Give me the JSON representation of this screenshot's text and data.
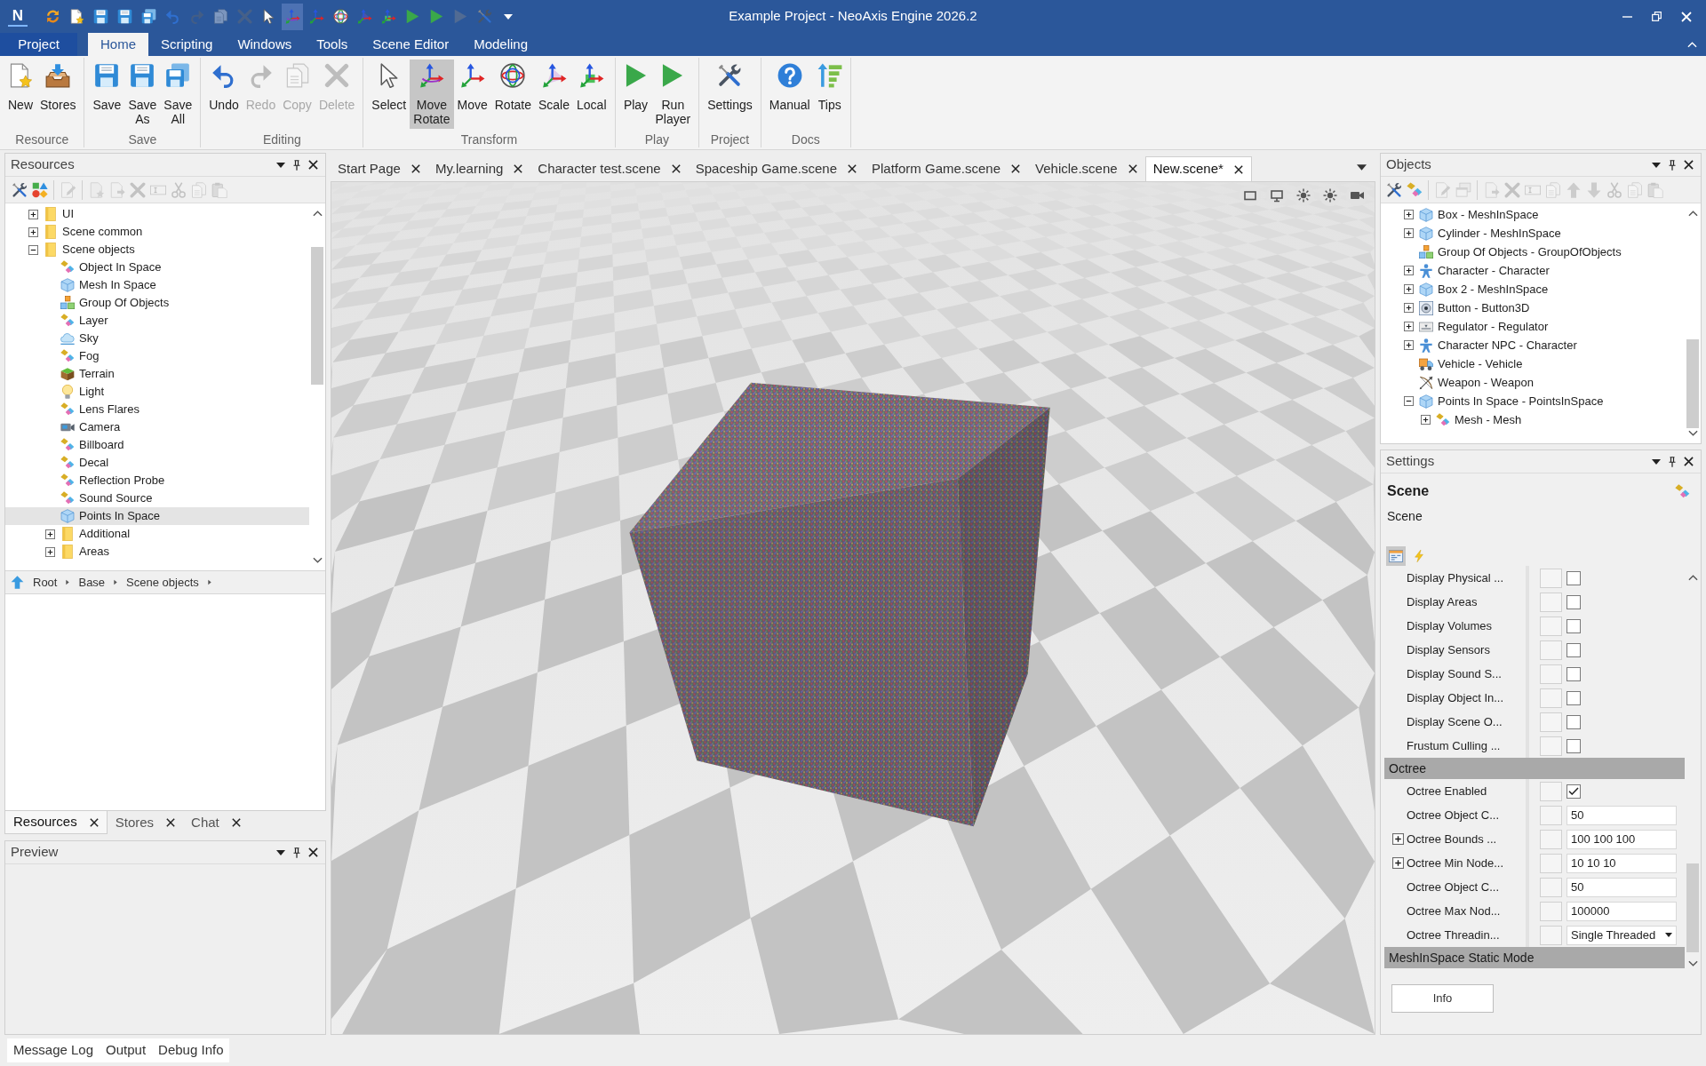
{
  "window": {
    "logo": "N",
    "title": "Example Project - NeoAxis Engine 2026.2"
  },
  "quick_access": [
    {
      "kind": "refresh",
      "selected": false,
      "disabled": false
    },
    {
      "kind": "new",
      "selected": false,
      "disabled": false
    },
    {
      "kind": "save",
      "selected": false,
      "disabled": false
    },
    {
      "kind": "saveas",
      "selected": false,
      "disabled": false
    },
    {
      "kind": "saveall",
      "selected": false,
      "disabled": false
    },
    {
      "kind": "undo",
      "selected": false,
      "disabled": false
    },
    {
      "kind": "redo",
      "selected": false,
      "disabled": true
    },
    {
      "kind": "copy",
      "selected": false,
      "disabled": true
    },
    {
      "kind": "delete",
      "selected": false,
      "disabled": true
    },
    {
      "kind": "select",
      "selected": false,
      "disabled": false
    },
    {
      "kind": "moverotate",
      "selected": true,
      "disabled": false
    },
    {
      "kind": "move",
      "selected": false,
      "disabled": false
    },
    {
      "kind": "rotate",
      "selected": false,
      "disabled": false
    },
    {
      "kind": "scale",
      "selected": false,
      "disabled": false
    },
    {
      "kind": "local",
      "selected": false,
      "disabled": false
    },
    {
      "kind": "play",
      "selected": false,
      "disabled": false
    },
    {
      "kind": "runplayer",
      "selected": false,
      "disabled": false
    },
    {
      "kind": "play",
      "selected": false,
      "disabled": true
    },
    {
      "kind": "settings",
      "selected": false,
      "disabled": false
    },
    {
      "kind": "customize",
      "selected": false,
      "disabled": false
    }
  ],
  "ribbon": {
    "tabs": [
      {
        "label": "Project",
        "kind": "menu",
        "selected": false
      },
      {
        "label": "Home",
        "kind": "tab",
        "selected": true
      },
      {
        "label": "Scripting",
        "kind": "tab",
        "selected": false
      },
      {
        "label": "Windows",
        "kind": "tab",
        "selected": false
      },
      {
        "label": "Tools",
        "kind": "tab",
        "selected": false
      },
      {
        "label": "Scene Editor",
        "kind": "tab",
        "selected": false
      },
      {
        "label": "Modeling",
        "kind": "tab",
        "selected": false
      }
    ],
    "groups": [
      {
        "label": "Resource",
        "buttons": [
          {
            "kind": "new",
            "label": "New",
            "selected": false,
            "disabled": false
          },
          {
            "kind": "stores",
            "label": "Stores",
            "selected": false,
            "disabled": false
          }
        ]
      },
      {
        "label": "Save",
        "buttons": [
          {
            "kind": "save",
            "label": "Save",
            "selected": false,
            "disabled": false
          },
          {
            "kind": "saveas",
            "label": "Save As",
            "selected": false,
            "disabled": false
          },
          {
            "kind": "saveall",
            "label": "Save All",
            "selected": false,
            "disabled": false
          }
        ]
      },
      {
        "label": "Editing",
        "buttons": [
          {
            "kind": "undo",
            "label": "Undo",
            "selected": false,
            "disabled": false
          },
          {
            "kind": "redo",
            "label": "Redo",
            "selected": false,
            "disabled": true
          },
          {
            "kind": "copy",
            "label": "Copy",
            "selected": false,
            "disabled": true
          },
          {
            "kind": "delete",
            "label": "Delete",
            "selected": false,
            "disabled": true
          }
        ]
      },
      {
        "label": "Transform",
        "buttons": [
          {
            "kind": "select",
            "label": "Select",
            "selected": false,
            "disabled": false
          },
          {
            "kind": "moverotate",
            "label": "Move Rotate",
            "selected": true,
            "disabled": false
          },
          {
            "kind": "move",
            "label": "Move",
            "selected": false,
            "disabled": false
          },
          {
            "kind": "rotate",
            "label": "Rotate",
            "selected": false,
            "disabled": false
          },
          {
            "kind": "scale",
            "label": "Scale",
            "selected": false,
            "disabled": false
          },
          {
            "kind": "local",
            "label": "Local",
            "selected": false,
            "disabled": false
          }
        ]
      },
      {
        "label": "Play",
        "buttons": [
          {
            "kind": "play",
            "label": "Play",
            "selected": false,
            "disabled": false
          },
          {
            "kind": "runplayer",
            "label": "Run Player",
            "selected": false,
            "disabled": false
          }
        ]
      },
      {
        "label": "Project",
        "buttons": [
          {
            "kind": "settings",
            "label": "Settings",
            "selected": false,
            "disabled": false
          }
        ]
      },
      {
        "label": "Docs",
        "buttons": [
          {
            "kind": "manual",
            "label": "Manual",
            "selected": false,
            "disabled": false
          },
          {
            "kind": "tips",
            "label": "Tips",
            "selected": false,
            "disabled": false
          }
        ]
      }
    ]
  },
  "resources_panel": {
    "title": "Resources",
    "toolbar": [
      {
        "kind": "settings",
        "disabled": false
      },
      {
        "kind": "create",
        "disabled": false
      },
      {
        "kind": "separator"
      },
      {
        "kind": "edit",
        "disabled": true
      },
      {
        "kind": "separator"
      },
      {
        "kind": "add",
        "disabled": true
      },
      {
        "kind": "import",
        "disabled": true
      },
      {
        "kind": "delete",
        "disabled": true
      },
      {
        "kind": "rename",
        "disabled": true
      },
      {
        "kind": "cut",
        "disabled": true
      },
      {
        "kind": "copy",
        "disabled": true
      },
      {
        "kind": "paste",
        "disabled": true
      }
    ],
    "tree": [
      {
        "label": "UI",
        "kind": "folder",
        "expanded": false,
        "selected": false
      },
      {
        "label": "Scene common",
        "kind": "folder",
        "expanded": false,
        "selected": false
      },
      {
        "label": "Scene objects",
        "kind": "folder",
        "expanded": true,
        "selected": false,
        "children": [
          {
            "label": "Object In Space",
            "kind": "component",
            "selected": false
          },
          {
            "label": "Mesh In Space",
            "kind": "mesh",
            "selected": false
          },
          {
            "label": "Group Of Objects",
            "kind": "group",
            "selected": false
          },
          {
            "label": "Layer",
            "kind": "component",
            "selected": false
          },
          {
            "label": "Sky",
            "kind": "sky",
            "selected": false
          },
          {
            "label": "Fog",
            "kind": "component",
            "selected": false
          },
          {
            "label": "Terrain",
            "kind": "terrain",
            "selected": false
          },
          {
            "label": "Light",
            "kind": "light",
            "selected": false
          },
          {
            "label": "Lens Flares",
            "kind": "component",
            "selected": false
          },
          {
            "label": "Camera",
            "kind": "camera",
            "selected": false
          },
          {
            "label": "Billboard",
            "kind": "component",
            "selected": false
          },
          {
            "label": "Decal",
            "kind": "component",
            "selected": false
          },
          {
            "label": "Reflection Probe",
            "kind": "component",
            "selected": false
          },
          {
            "label": "Sound Source",
            "kind": "component",
            "selected": false
          },
          {
            "label": "Points In Space",
            "kind": "mesh",
            "selected": true
          },
          {
            "label": "Additional",
            "kind": "folder",
            "expanded": false,
            "selected": false
          },
          {
            "label": "Areas",
            "kind": "folder",
            "expanded": false,
            "selected": false
          }
        ]
      }
    ],
    "breadcrumb": [
      "Root",
      "Base",
      "Scene objects"
    ],
    "tabs": [
      {
        "label": "Resources",
        "selected": true
      },
      {
        "label": "Stores",
        "selected": false
      },
      {
        "label": "Chat",
        "selected": false
      }
    ]
  },
  "preview_panel": {
    "title": "Preview"
  },
  "document_tabs": [
    {
      "label": "Start Page",
      "selected": false
    },
    {
      "label": "My.learning",
      "selected": false
    },
    {
      "label": "Character test.scene",
      "selected": false
    },
    {
      "label": "Spaceship Game.scene",
      "selected": false
    },
    {
      "label": "Platform Game.scene",
      "selected": false
    },
    {
      "label": "Vehicle.scene",
      "selected": false
    },
    {
      "label": "New.scene*",
      "selected": true
    }
  ],
  "objects_panel": {
    "title": "Objects",
    "toolbar": [
      {
        "kind": "settings",
        "disabled": false
      },
      {
        "kind": "component",
        "disabled": false
      },
      {
        "kind": "separator"
      },
      {
        "kind": "edit",
        "disabled": true
      },
      {
        "kind": "windows",
        "disabled": true
      },
      {
        "kind": "separator"
      },
      {
        "kind": "import",
        "disabled": true
      },
      {
        "kind": "delete",
        "disabled": true
      },
      {
        "kind": "rename",
        "disabled": true
      },
      {
        "kind": "duplicate",
        "disabled": true
      },
      {
        "kind": "moveup",
        "disabled": true
      },
      {
        "kind": "movedown",
        "disabled": true
      },
      {
        "kind": "cut",
        "disabled": true
      },
      {
        "kind": "copy",
        "disabled": true
      },
      {
        "kind": "paste",
        "disabled": true
      }
    ],
    "tree": [
      {
        "label": "Box - MeshInSpace",
        "kind": "mesh",
        "expanded": false,
        "selected": false
      },
      {
        "label": "Cylinder - MeshInSpace",
        "kind": "mesh",
        "expanded": false,
        "selected": false
      },
      {
        "label": "Group Of Objects - GroupOfObjects",
        "kind": "group",
        "selected": false
      },
      {
        "label": "Character - Character",
        "kind": "character",
        "expanded": false,
        "selected": false
      },
      {
        "label": "Box 2 - MeshInSpace",
        "kind": "mesh",
        "expanded": false,
        "selected": false
      },
      {
        "label": "Button - Button3D",
        "kind": "button",
        "expanded": false,
        "selected": false
      },
      {
        "label": "Regulator - Regulator",
        "kind": "regulator",
        "expanded": false,
        "selected": false
      },
      {
        "label": "Character NPC - Character",
        "kind": "character",
        "expanded": false,
        "selected": false
      },
      {
        "label": "Vehicle - Vehicle",
        "kind": "vehicle",
        "selected": false
      },
      {
        "label": "Weapon - Weapon",
        "kind": "weapon",
        "selected": false
      },
      {
        "label": "Points In Space - PointsInSpace",
        "kind": "mesh",
        "expanded": true,
        "selected": false,
        "children": [
          {
            "label": "Mesh - Mesh",
            "kind": "component",
            "expanded": false,
            "selected": false
          }
        ]
      }
    ]
  },
  "settings_panel": {
    "title": "Settings",
    "object_name": "Scene",
    "object_type": "Scene",
    "tabs": [
      {
        "kind": "properties",
        "selected": true
      },
      {
        "kind": "events",
        "selected": false
      }
    ],
    "properties": [
      {
        "kind": "checkbox",
        "label": "Display Physical ...",
        "checked": false
      },
      {
        "kind": "checkbox",
        "label": "Display Areas",
        "checked": false
      },
      {
        "kind": "checkbox",
        "label": "Display Volumes",
        "checked": false
      },
      {
        "kind": "checkbox",
        "label": "Display Sensors",
        "checked": false
      },
      {
        "kind": "checkbox",
        "label": "Display Sound S...",
        "checked": false
      },
      {
        "kind": "checkbox",
        "label": "Display Object In...",
        "checked": false
      },
      {
        "kind": "checkbox",
        "label": "Display Scene O...",
        "checked": false
      },
      {
        "kind": "checkbox",
        "label": "Frustum Culling ...",
        "checked": false
      },
      {
        "kind": "category",
        "label": "Octree"
      },
      {
        "kind": "checkbox",
        "label": "Octree Enabled",
        "checked": true
      },
      {
        "kind": "text",
        "label": "Octree Object C...",
        "value": "50"
      },
      {
        "kind": "text",
        "label": "Octree Bounds ...",
        "value": "100 100 100",
        "expanded": false
      },
      {
        "kind": "text",
        "label": "Octree Min Node...",
        "value": "10 10 10",
        "expanded": false
      },
      {
        "kind": "text",
        "label": "Octree Object C...",
        "value": "50"
      },
      {
        "kind": "text",
        "label": "Octree Max Nod...",
        "value": "100000"
      },
      {
        "kind": "dropdown",
        "label": "Octree Threadin...",
        "value": "Single Threaded"
      },
      {
        "kind": "category",
        "label": "MeshInSpace Static Mode"
      }
    ],
    "buttons": [
      "Info"
    ]
  },
  "bottom_tabs": [
    "Message Log",
    "Output",
    "Debug Info"
  ]
}
